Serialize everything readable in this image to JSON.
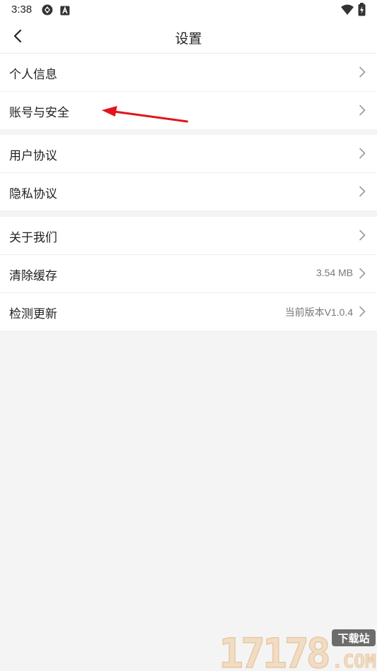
{
  "status_bar": {
    "time": "3:38",
    "icons": [
      "sync-icon",
      "a-badge-icon",
      "wifi-icon",
      "battery-charging-icon"
    ]
  },
  "header": {
    "title": "设置",
    "back_icon": "chevron-left-icon"
  },
  "groups": [
    {
      "items": [
        {
          "label": "个人信息",
          "value": ""
        },
        {
          "label": "账号与安全",
          "value": ""
        }
      ]
    },
    {
      "items": [
        {
          "label": "用户协议",
          "value": ""
        },
        {
          "label": "隐私协议",
          "value": ""
        }
      ]
    },
    {
      "items": [
        {
          "label": "关于我们",
          "value": ""
        },
        {
          "label": "清除缓存",
          "value": "3.54 MB"
        },
        {
          "label": "检测更新",
          "value": "当前版本V1.0.4"
        }
      ]
    }
  ],
  "annotation": {
    "color": "#e3141b",
    "target": "账号与安全"
  },
  "watermark": {
    "main": "17178",
    "sub": ".COM",
    "tag": "下载站"
  },
  "colors": {
    "background": "#f4f4f4",
    "surface": "#ffffff",
    "text": "#222222",
    "secondary_text": "#777777",
    "chevron": "#9a9a9a"
  }
}
